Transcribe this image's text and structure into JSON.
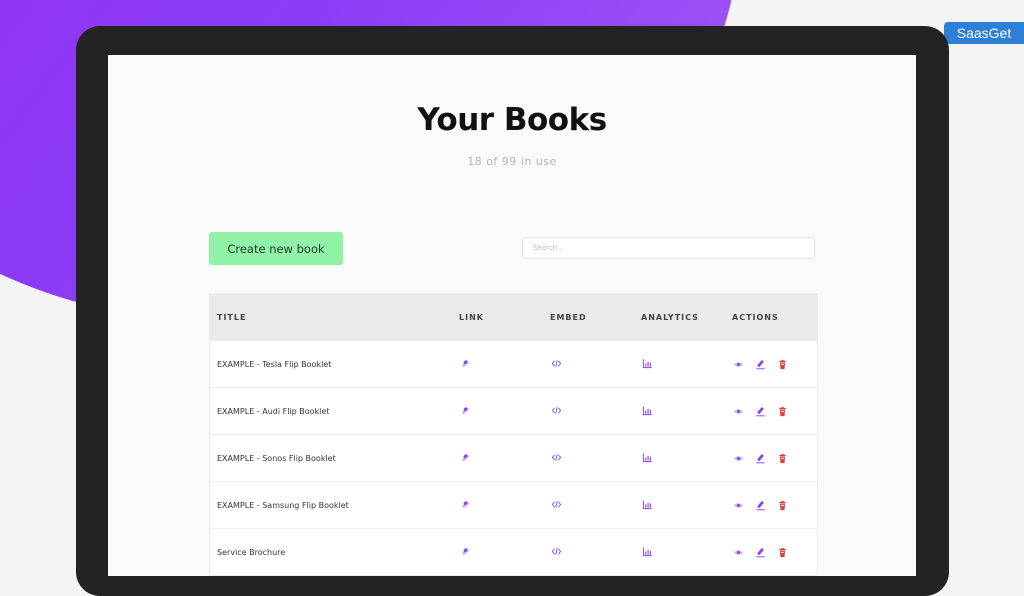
{
  "watermark": "SaasGet",
  "page": {
    "title": "Your Books",
    "subtitle": "18 of 99 in use"
  },
  "toolbar": {
    "create_label": "Create new book",
    "search_placeholder": "Search..."
  },
  "table": {
    "headers": [
      "TITLE",
      "LINK",
      "EMBED",
      "ANALYTICS",
      "ACTIONS"
    ],
    "rows": [
      {
        "title": "EXAMPLE - Tesla Flip Booklet"
      },
      {
        "title": "EXAMPLE - Audi Flip Booklet"
      },
      {
        "title": "EXAMPLE - Sonos Flip Booklet"
      },
      {
        "title": "EXAMPLE - Samsung Flip Booklet"
      },
      {
        "title": "Service Brochure"
      }
    ]
  },
  "icons": {
    "link": "link-icon",
    "embed": "code-icon",
    "analytics": "bar-chart-icon",
    "view": "eye-icon",
    "edit": "pencil-icon",
    "delete": "trash-icon"
  },
  "colors": {
    "accent": "#8b3cf5",
    "button": "#8ff2a7",
    "delete": "#d94040",
    "link_icon": "#b38ef0",
    "watermark_bg": "#2f7fd6"
  }
}
